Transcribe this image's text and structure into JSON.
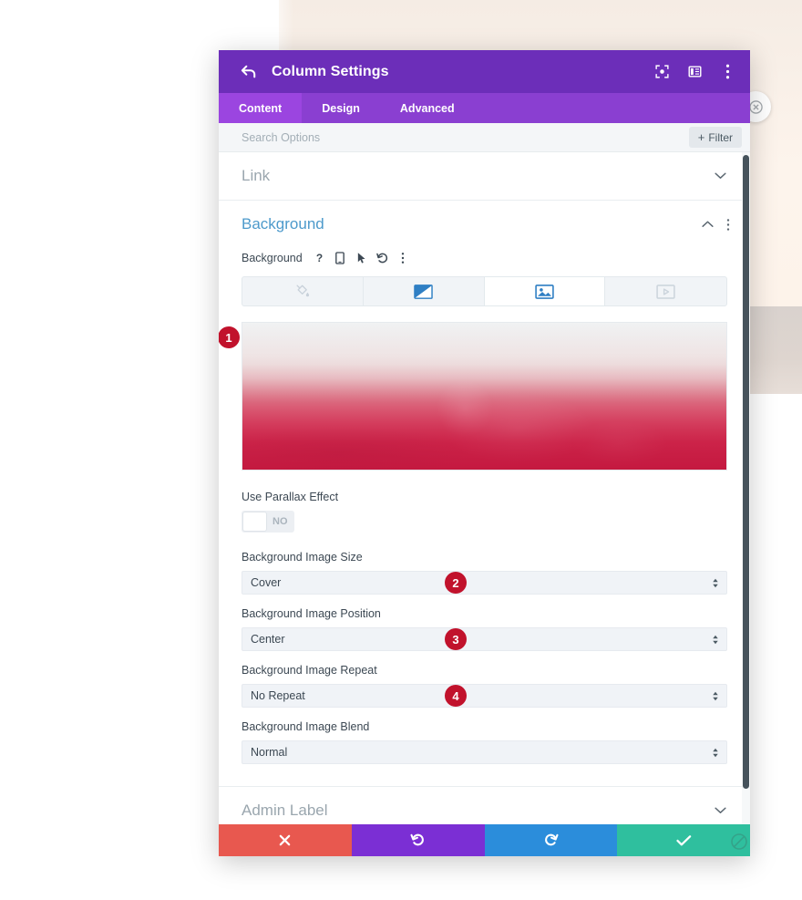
{
  "modal": {
    "title": "Column Settings",
    "back_icon": "back-arrow-icon",
    "header_icons": [
      {
        "name": "focus-view-icon"
      },
      {
        "name": "layout-panel-icon"
      },
      {
        "name": "more-options-icon"
      }
    ],
    "tabs": [
      {
        "label": "Content",
        "active": true
      },
      {
        "label": "Design",
        "active": false
      },
      {
        "label": "Advanced",
        "active": false
      }
    ],
    "search": {
      "placeholder": "Search Options",
      "value": ""
    },
    "filter": {
      "label": "Filter",
      "plus": "+"
    }
  },
  "sections": {
    "link": {
      "label": "Link",
      "state": "collapsed",
      "chevron": "chevron-down-icon"
    },
    "background": {
      "label": "Background",
      "state": "expanded",
      "chevron": "chevron-up-icon",
      "more": "more-options-icon"
    },
    "admin_label": {
      "label": "Admin Label",
      "state": "collapsed",
      "chevron": "chevron-down-icon"
    }
  },
  "background_field": {
    "label": "Background",
    "inline_icons": [
      {
        "name": "help-icon",
        "glyph": "?"
      },
      {
        "name": "responsive-mobile-icon"
      },
      {
        "name": "hover-cursor-icon"
      },
      {
        "name": "reset-undo-icon"
      },
      {
        "name": "more-options-icon"
      }
    ],
    "types": [
      {
        "name": "background-color-tab",
        "icon": "paint-bucket-icon",
        "active": false
      },
      {
        "name": "background-gradient-tab",
        "icon": "gradient-icon",
        "active": false
      },
      {
        "name": "background-image-tab",
        "icon": "image-icon",
        "active": true
      },
      {
        "name": "background-video-tab",
        "icon": "video-icon",
        "active": false
      }
    ]
  },
  "image_preview": {
    "name": "background-image-preview",
    "badge": "1",
    "description": "cityscape with red gradient overlay"
  },
  "parallax": {
    "label": "Use Parallax Effect",
    "toggle_value": "NO",
    "enabled": false
  },
  "fields": [
    {
      "name": "background-image-size",
      "label": "Background Image Size",
      "value": "Cover",
      "badge": "2"
    },
    {
      "name": "background-image-position",
      "label": "Background Image Position",
      "value": "Center",
      "badge": "3"
    },
    {
      "name": "background-image-repeat",
      "label": "Background Image Repeat",
      "value": "No Repeat",
      "badge": "4"
    },
    {
      "name": "background-image-blend",
      "label": "Background Image Blend",
      "value": "Normal",
      "badge": ""
    }
  ],
  "footer_buttons": [
    {
      "name": "cancel-button",
      "icon": "close-x-icon",
      "color": "#e8584f"
    },
    {
      "name": "undo-button",
      "icon": "undo-icon",
      "color": "#7b2fd4"
    },
    {
      "name": "redo-button",
      "icon": "redo-icon",
      "color": "#2b8ddb"
    },
    {
      "name": "save-button",
      "icon": "checkmark-icon",
      "color": "#2fbf9e"
    }
  ],
  "colors": {
    "header_purple": "#6c2eb9",
    "tabs_purple": "#8a3fd1",
    "active_tab_purple": "#9b45e0",
    "section_blue": "#4d9acb",
    "badge_red": "#c1122c",
    "scrollbar": "#46535c"
  }
}
